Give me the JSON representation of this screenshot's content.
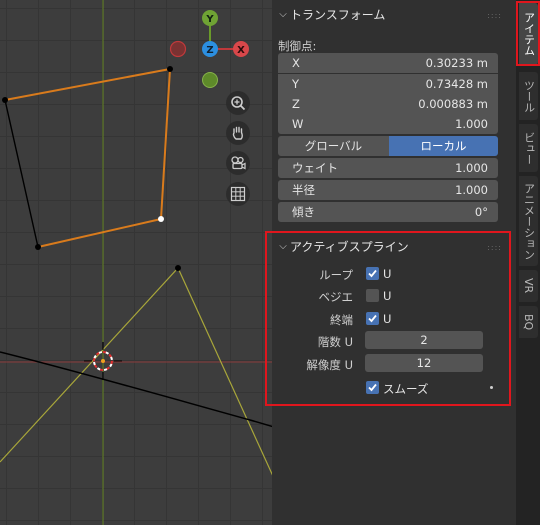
{
  "viewport": {
    "nav_buttons": [
      {
        "name": "zoom-icon"
      },
      {
        "name": "hand-pan-icon"
      },
      {
        "name": "camera-icon"
      },
      {
        "name": "grid-ortho-icon"
      }
    ],
    "gizmo": {
      "x": "X",
      "y": "Y",
      "z": "Z"
    }
  },
  "transform": {
    "title": "トランスフォーム",
    "control_point_label": "制御点:",
    "fields": [
      {
        "label": "X",
        "value": "0.30233 m"
      },
      {
        "label": "Y",
        "value": "0.73428 m"
      },
      {
        "label": "Z",
        "value": "0.000883 m"
      },
      {
        "label": "W",
        "value": "1.000"
      }
    ],
    "global_label": "グローバル",
    "local_label": "ローカル",
    "weight": {
      "label": "ウェイト",
      "value": "1.000"
    },
    "radius": {
      "label": "半径",
      "value": "1.000"
    },
    "tilt": {
      "label": "傾き",
      "value": "0°"
    }
  },
  "active_spline": {
    "title": "アクティブスプライン",
    "loop": {
      "label": "ループ",
      "check": "U",
      "checked": true
    },
    "bezier": {
      "label": "ベジエ",
      "check": "U",
      "checked": false
    },
    "endpoint": {
      "label": "終端",
      "check": "U",
      "checked": true
    },
    "order": {
      "label": "階数 U",
      "value": "2"
    },
    "resolution": {
      "label": "解像度 U",
      "value": "12"
    },
    "smooth": {
      "label": "スムーズ",
      "checked": true
    }
  },
  "tabs": [
    "アイテム",
    "ツール",
    "ビュー",
    "アニメーション",
    "VR",
    "BQ"
  ],
  "colors": {
    "accent": "#4772b3",
    "highlight": "#e0161d",
    "curve_orange": "#d97b1c",
    "curve_yellow": "#a8a63a"
  }
}
